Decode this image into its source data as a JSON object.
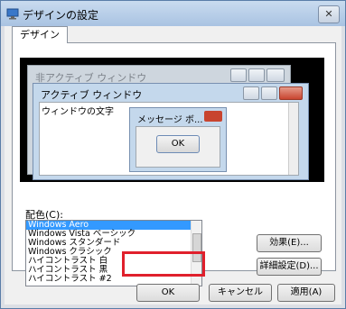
{
  "window": {
    "title": "デザインの設定",
    "close_glyph": "✕"
  },
  "tab": {
    "label": "デザイン"
  },
  "preview": {
    "inactive_title": "非アクティブ ウィンドウ",
    "active_title": "アクティブ ウィンドウ",
    "window_text": "ウィンドウの文字",
    "message_title": "メッセージ ボ...",
    "message_ok": "OK"
  },
  "color_scheme": {
    "label": "配色(C):",
    "items": [
      "Windows Aero",
      "Windows Vista ベーシック",
      "Windows スタンダード",
      "Windows クラシック",
      "ハイコントラスト 白",
      "ハイコントラスト 黒",
      "ハイコントラスト #2"
    ],
    "selected_index": 0
  },
  "buttons": {
    "effects": "効果(E)...",
    "advanced": "詳細設定(D)...",
    "ok": "OK",
    "cancel": "キャンセル",
    "apply": "適用(A)"
  },
  "colors": {
    "highlight": "#e0202c",
    "selection": "#3399ff"
  }
}
